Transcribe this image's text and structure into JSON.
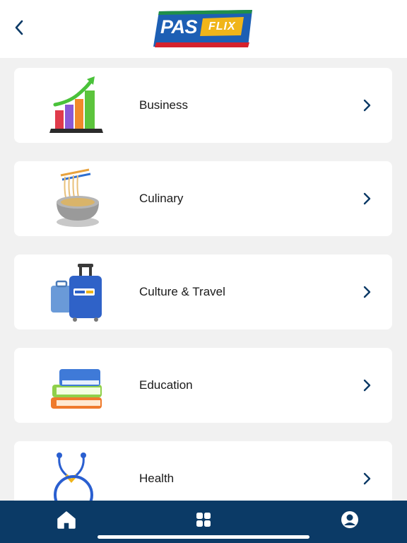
{
  "header": {
    "back_icon": "chevron-left-icon",
    "logo": {
      "pas": "PAS",
      "flix": "FLIX"
    }
  },
  "categories": [
    {
      "label": "Business",
      "icon": "business-growth-chart-icon"
    },
    {
      "label": "Culinary",
      "icon": "noodle-bowl-icon"
    },
    {
      "label": "Culture & Travel",
      "icon": "suitcase-icon"
    },
    {
      "label": "Education",
      "icon": "book-stack-icon"
    },
    {
      "label": "Health",
      "icon": "stethoscope-icon"
    }
  ],
  "tabbar": {
    "items": [
      {
        "name": "home",
        "icon": "home-icon",
        "active": true
      },
      {
        "name": "categories",
        "icon": "grid-icon",
        "active": false
      },
      {
        "name": "profile",
        "icon": "user-icon",
        "active": false
      }
    ]
  },
  "colors": {
    "nav_background": "#0b3a66",
    "page_background": "#f1f1f1",
    "chevron": "#0b3a66",
    "logo_blue": "#1d5fb4",
    "logo_gold": "#f0b51a",
    "logo_red": "#d6212c"
  }
}
